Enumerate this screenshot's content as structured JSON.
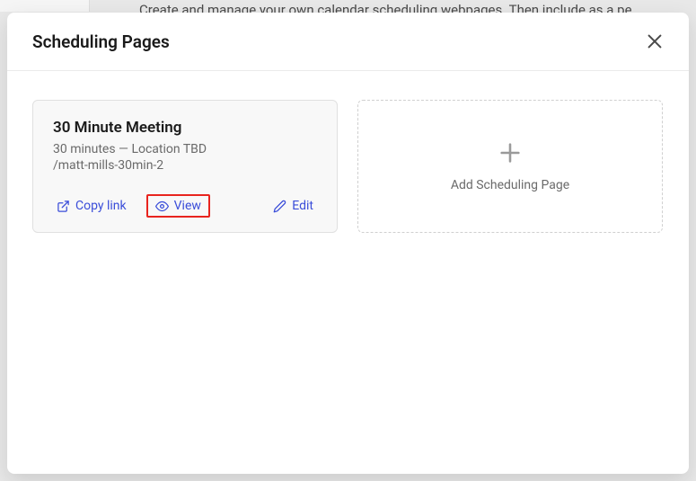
{
  "backdrop": {
    "text": "Create and manage your own calendar scheduling webpages. Then include as a pe"
  },
  "modal": {
    "title": "Scheduling Pages"
  },
  "card": {
    "title": "30 Minute Meeting",
    "subtitle": "30 minutes — Location TBD",
    "slug": "/matt-mills-30min-2",
    "actions": {
      "copy_link": "Copy link",
      "view": "View",
      "edit": "Edit"
    }
  },
  "add": {
    "label": "Add Scheduling Page"
  }
}
